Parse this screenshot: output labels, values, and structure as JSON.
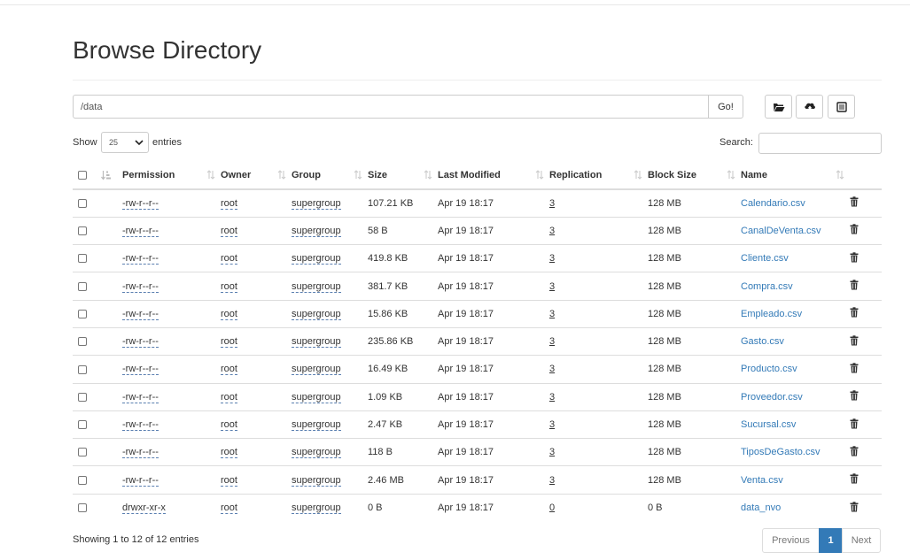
{
  "page": {
    "title": "Browse Directory"
  },
  "pathbar": {
    "value": "/data",
    "go_label": "Go!"
  },
  "toolbar": {
    "create_dir_icon": "folder-open-icon",
    "upload_icon": "cloud-upload-icon",
    "cut_paste_icon": "list-alt-icon"
  },
  "table_controls": {
    "show_label": "Show",
    "page_length": "25",
    "entries_label": "entries",
    "search_label": "Search:",
    "search_value": ""
  },
  "columns": [
    "Permission",
    "Owner",
    "Group",
    "Size",
    "Last Modified",
    "Replication",
    "Block Size",
    "Name"
  ],
  "rows": [
    {
      "permission": "-rw-r--r--",
      "owner": "root",
      "group": "supergroup",
      "size": "107.21 KB",
      "modified": "Apr 19 18:17",
      "replication": "3",
      "block_size": "128 MB",
      "name": "Calendario.csv"
    },
    {
      "permission": "-rw-r--r--",
      "owner": "root",
      "group": "supergroup",
      "size": "58 B",
      "modified": "Apr 19 18:17",
      "replication": "3",
      "block_size": "128 MB",
      "name": "CanalDeVenta.csv"
    },
    {
      "permission": "-rw-r--r--",
      "owner": "root",
      "group": "supergroup",
      "size": "419.8 KB",
      "modified": "Apr 19 18:17",
      "replication": "3",
      "block_size": "128 MB",
      "name": "Cliente.csv"
    },
    {
      "permission": "-rw-r--r--",
      "owner": "root",
      "group": "supergroup",
      "size": "381.7 KB",
      "modified": "Apr 19 18:17",
      "replication": "3",
      "block_size": "128 MB",
      "name": "Compra.csv"
    },
    {
      "permission": "-rw-r--r--",
      "owner": "root",
      "group": "supergroup",
      "size": "15.86 KB",
      "modified": "Apr 19 18:17",
      "replication": "3",
      "block_size": "128 MB",
      "name": "Empleado.csv"
    },
    {
      "permission": "-rw-r--r--",
      "owner": "root",
      "group": "supergroup",
      "size": "235.86 KB",
      "modified": "Apr 19 18:17",
      "replication": "3",
      "block_size": "128 MB",
      "name": "Gasto.csv"
    },
    {
      "permission": "-rw-r--r--",
      "owner": "root",
      "group": "supergroup",
      "size": "16.49 KB",
      "modified": "Apr 19 18:17",
      "replication": "3",
      "block_size": "128 MB",
      "name": "Producto.csv"
    },
    {
      "permission": "-rw-r--r--",
      "owner": "root",
      "group": "supergroup",
      "size": "1.09 KB",
      "modified": "Apr 19 18:17",
      "replication": "3",
      "block_size": "128 MB",
      "name": "Proveedor.csv"
    },
    {
      "permission": "-rw-r--r--",
      "owner": "root",
      "group": "supergroup",
      "size": "2.47 KB",
      "modified": "Apr 19 18:17",
      "replication": "3",
      "block_size": "128 MB",
      "name": "Sucursal.csv"
    },
    {
      "permission": "-rw-r--r--",
      "owner": "root",
      "group": "supergroup",
      "size": "118 B",
      "modified": "Apr 19 18:17",
      "replication": "3",
      "block_size": "128 MB",
      "name": "TiposDeGasto.csv"
    },
    {
      "permission": "-rw-r--r--",
      "owner": "root",
      "group": "supergroup",
      "size": "2.46 MB",
      "modified": "Apr 19 18:17",
      "replication": "3",
      "block_size": "128 MB",
      "name": "Venta.csv"
    },
    {
      "permission": "drwxr-xr-x",
      "owner": "root",
      "group": "supergroup",
      "size": "0 B",
      "modified": "Apr 19 18:17",
      "replication": "0",
      "block_size": "0 B",
      "name": "data_nvo"
    }
  ],
  "footer": {
    "info": "Showing 1 to 12 of 12 entries",
    "prev_label": "Previous",
    "current_page": "1",
    "next_label": "Next"
  },
  "colors": {
    "link": "#337ab7",
    "active_page": "#337ab7",
    "border": "#dddddd"
  }
}
